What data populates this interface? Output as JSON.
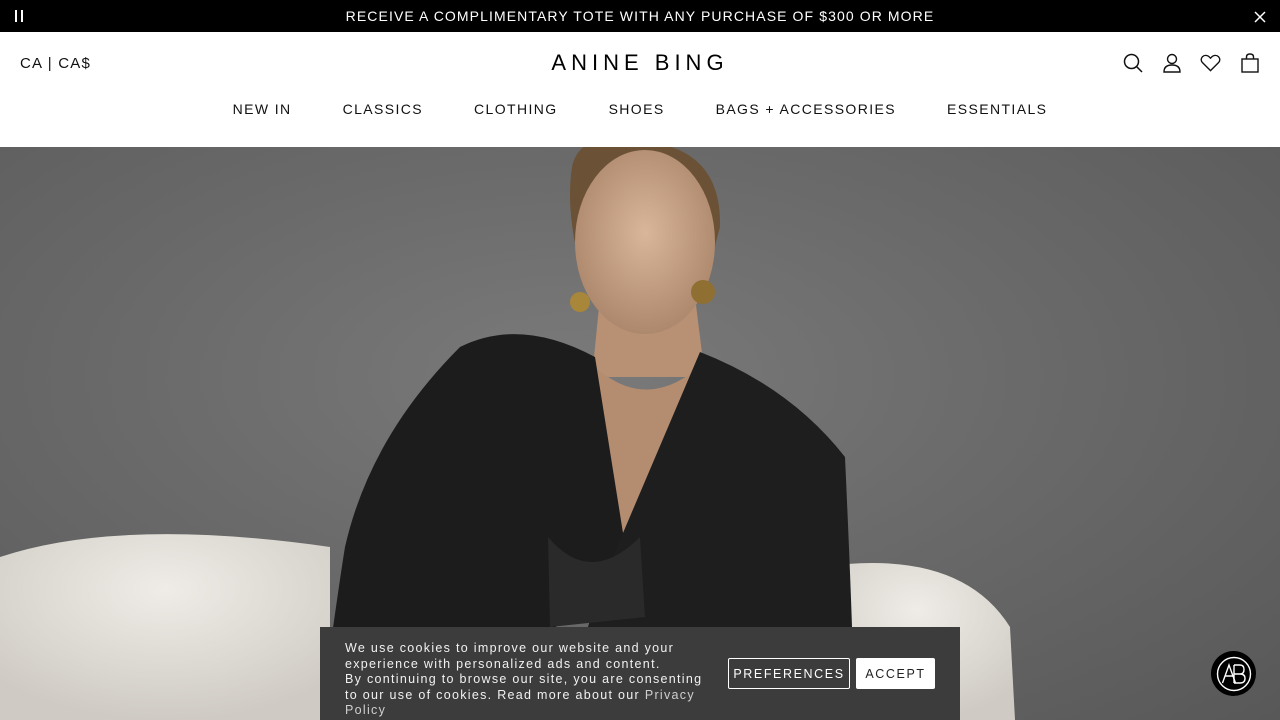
{
  "announcement": {
    "text": "RECEIVE A COMPLIMENTARY TOTE WITH ANY PURCHASE OF $300 OR MORE"
  },
  "header": {
    "locale": "CA | CA$",
    "logo": "ANINE BING",
    "icons": [
      "search-icon",
      "account-icon",
      "wishlist-icon",
      "bag-icon"
    ]
  },
  "nav": {
    "items": [
      {
        "label": "NEW IN"
      },
      {
        "label": "CLASSICS"
      },
      {
        "label": "CLOTHING"
      },
      {
        "label": "SHOES"
      },
      {
        "label": "BAGS + ACCESSORIES"
      },
      {
        "label": "ESSENTIALS"
      }
    ]
  },
  "cookie": {
    "line1": "We use cookies to improve our website and your experience with personalized ads and content.",
    "line2": "By continuing to browse our site, you are consenting to our use of cookies. Read more about our",
    "link": "Privacy Policy",
    "preferences_label": "PREFERENCES",
    "accept_label": "ACCEPT"
  },
  "badge": {
    "monogram": "AB"
  },
  "colors": {
    "announce_bg": "#000000",
    "cookie_bg": "#3c3c3c",
    "hero_bg": "#6a6a6a"
  }
}
